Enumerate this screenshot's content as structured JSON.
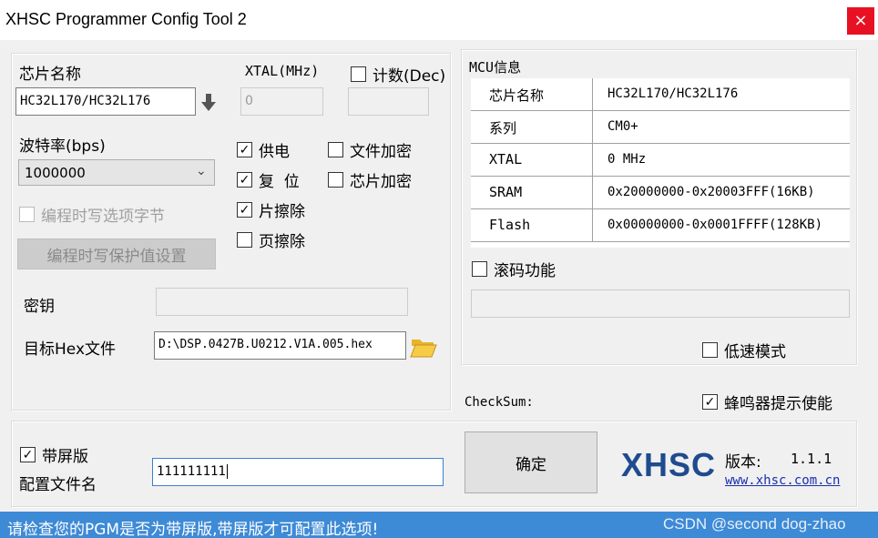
{
  "window": {
    "title": "XHSC Programmer Config Tool 2",
    "close_glyph": "×"
  },
  "left": {
    "chip_name_label": "芯片名称",
    "chip_name_value": "HC32L170/HC32L176",
    "xtal_label": "XTAL(MHz)",
    "xtal_value": "0",
    "count_label": "计数(Dec)",
    "baud_label": "波特率(bps)",
    "baud_value": "1000000",
    "power_label": "供电",
    "reset_label": "复  位",
    "chip_erase_label": "片擦除",
    "page_erase_label": "页擦除",
    "file_encrypt_label": "文件加密",
    "chip_encrypt_label": "芯片加密",
    "write_option_label": "编程时写选项字节",
    "protect_button_label": "编程时写保护值设置",
    "key_label": "密钥",
    "hex_label": "目标Hex文件",
    "hex_value": "D:\\DSP.0427B.U0212.V1A.005.hex"
  },
  "mcu": {
    "title": "MCU信息",
    "rows": [
      {
        "key": "芯片名称",
        "value": "HC32L170/HC32L176"
      },
      {
        "key": "系列",
        "value": "CM0+"
      },
      {
        "key": "XTAL",
        "value": "0 MHz"
      },
      {
        "key": "SRAM",
        "value": "0x20000000-0x20003FFF(16KB)"
      },
      {
        "key": "Flash",
        "value": "0x00000000-0x0001FFFF(128KB)"
      }
    ],
    "rolling_label": "滚码功能",
    "low_speed_label": "低速模式",
    "checksum_label": "CheckSum:",
    "buzzer_label": "蜂鸣器提示使能"
  },
  "bottom": {
    "screen_label": "带屏版",
    "config_name_label": "配置文件名",
    "config_name_value": "111111111",
    "confirm_label": "确定",
    "logo_text": "XHSC",
    "version_label": "版本:",
    "version_value": "1.1.1",
    "site": "www.xhsc.com.cn"
  },
  "status": {
    "message": "请检查您的PGM是否为带屏版,带屏版才可配置此选项!",
    "watermark": "CSDN @second dog-zhao"
  },
  "checks": {
    "count": false,
    "power": true,
    "reset": true,
    "chip_erase": true,
    "page_erase": false,
    "file_encrypt": false,
    "chip_encrypt": false,
    "write_option": false,
    "rolling": false,
    "low_speed": false,
    "buzzer": true,
    "screen": true
  },
  "colors": {
    "statusbar": "#3d8ad6",
    "close": "#e81123",
    "logo": "#1f4b8f",
    "link": "#1a2fb0"
  }
}
